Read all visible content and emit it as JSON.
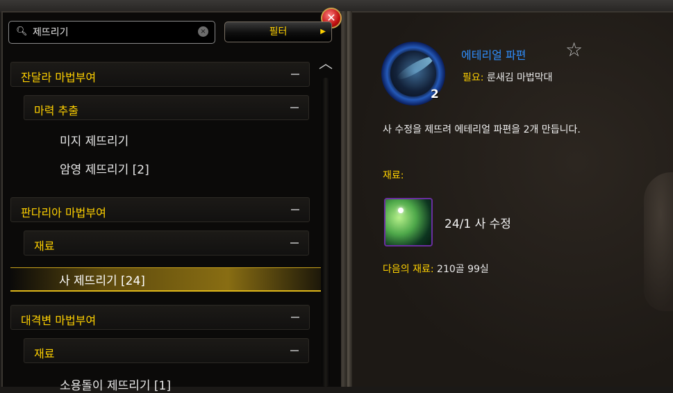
{
  "search": {
    "value": "제뜨리기"
  },
  "filter": {
    "label": "필터"
  },
  "list": {
    "categories": [
      {
        "label": "잔달라 마법부여"
      },
      {
        "label": "판다리아 마법부여"
      },
      {
        "label": "대격변 마법부여"
      }
    ],
    "subcategories": [
      {
        "label": "마력 추출"
      },
      {
        "label": "재료"
      },
      {
        "label": "재료"
      }
    ],
    "items": [
      {
        "label": "미지 제뜨리기"
      },
      {
        "label": "암영 제뜨리기 [2]"
      },
      {
        "label": "사 제뜨리기 [24]"
      },
      {
        "label": "소용돌이 제뜨리기 [1]"
      }
    ]
  },
  "detail": {
    "item_name": "에테리얼 파편",
    "icon_count": "2",
    "requires_label": "필요:",
    "requires_value": "룬새김 마법막대",
    "description": "사 수정을 제뜨려 에테리얼 파편을 2개 만듭니다.",
    "reagents_heading": "재료:",
    "reagent_text": "24/1 사 수정",
    "next_rank_label": "다음의 재료:",
    "next_rank_value": "210골 99실"
  },
  "icons": {
    "search": "magnifier-icon",
    "clear": "clear-search-icon",
    "close": "close-icon",
    "favorite": "star-icon",
    "scroll_up": "chevron-up-icon"
  },
  "colors": {
    "gold_text": "#ffd100",
    "item_name_blue": "#2f8fff",
    "selection": "#e0b81a"
  }
}
